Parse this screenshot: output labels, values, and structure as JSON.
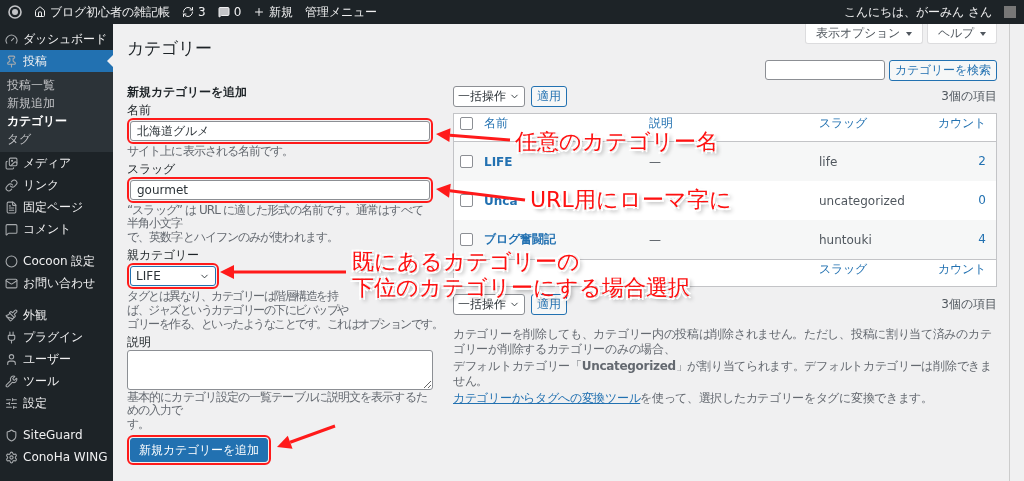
{
  "admin_bar": {
    "site_name": "ブログ初心者の雑記帳",
    "updates": "3",
    "comments": "0",
    "new_label": "新規",
    "menu_label": "管理メニュー",
    "greeting": "こんにちは、がーみん さん"
  },
  "sidebar": {
    "items": [
      {
        "label": "ダッシュボード",
        "selected": false
      },
      {
        "label": "投稿",
        "selected": true,
        "children": [
          {
            "label": "投稿一覧",
            "selected": false
          },
          {
            "label": "新規追加",
            "selected": false
          },
          {
            "label": "カテゴリー",
            "selected": true
          },
          {
            "label": "タグ",
            "selected": false
          }
        ]
      },
      {
        "label": "メディア",
        "selected": false
      },
      {
        "label": "リンク",
        "selected": false
      },
      {
        "label": "固定ページ",
        "selected": false
      },
      {
        "label": "コメント",
        "selected": false
      },
      {
        "label": "Cocoon 設定",
        "selected": false
      },
      {
        "label": "お問い合わせ",
        "selected": false
      },
      {
        "label": "外観",
        "selected": false
      },
      {
        "label": "プラグイン",
        "selected": false
      },
      {
        "label": "ユーザー",
        "selected": false
      },
      {
        "label": "ツール",
        "selected": false
      },
      {
        "label": "設定",
        "selected": false
      },
      {
        "label": "SiteGuard",
        "selected": false
      },
      {
        "label": "ConoHa WING",
        "selected": false
      }
    ]
  },
  "screen_tabs": [
    "表示オプション",
    "ヘルプ"
  ],
  "title": "カテゴリー",
  "search": {
    "button": "カテゴリーを検索"
  },
  "form": {
    "heading": "新規カテゴリーを追加",
    "fields": [
      {
        "kind": "text",
        "label": "名前",
        "value": "北海道グルメ",
        "highlighted": true,
        "help": [
          "サイト上に表示される名前です。"
        ]
      },
      {
        "kind": "text",
        "label": "スラッグ",
        "value": "gourmet",
        "highlighted": true,
        "help": [
          "“スラッグ” は URL に適した形式の名前です。通常はすべて半角小文字",
          "で、英数字とハイフンのみが使われます。"
        ]
      },
      {
        "kind": "select",
        "label": "親カテゴリー",
        "value": "LIFE",
        "highlighted": true,
        "help": [
          "タグとは異なり、カテゴリーは階層構造を持",
          "ば、ジャズというカテゴリーの下にビバップや",
          "ゴリーを作る、といったようなことです。これはオプションです。"
        ]
      },
      {
        "kind": "textarea",
        "label": "説明",
        "help": [
          "基本的にカテゴリ設定の一覧テーブルに説明文を表示するための入力で",
          "す。"
        ]
      }
    ],
    "submit": "新規カテゴリーを追加",
    "submit_highlighted": true
  },
  "table": {
    "top_nav": {
      "bulk_action": "一括操作",
      "apply": "適用",
      "item_count": "3個の項目"
    },
    "select_all_checked": false,
    "columns": [
      "名前",
      "説明",
      "スラッグ",
      "カウント"
    ],
    "rows": [
      {
        "name": "LIFE",
        "description": "—",
        "slug": "life",
        "count": "2",
        "checked": false
      },
      {
        "name": "Unca",
        "description": "",
        "slug": "uncategorized",
        "count": "0",
        "checked": false
      },
      {
        "name": "ブログ奮闘記",
        "description": "—",
        "slug": "huntouki",
        "count": "4",
        "checked": false
      }
    ],
    "footer_columns": [
      "スラッグ",
      "カウント"
    ],
    "bottom_nav": {
      "bulk_action": "一括操作",
      "apply": "適用",
      "item_count": "3個の項目"
    }
  },
  "notes": {
    "paragraphs": [
      "カテゴリーを削除しても、カテゴリー内の投稿は削除されません。ただし、投稿に割り当て済みのカテゴリーが削除するカテゴリーのみの場合、",
      "デフォルトカテゴリー「**Uncategorized**」が割り当てられます。デフォルトカテゴリーは削除できません。"
    ],
    "link": "カテゴリーからタグへの変換ツール",
    "link_suffix": "を使って、選択したカテゴリーをタグに変換できます。"
  },
  "annotations": [
    "任意のカテゴリー名",
    "URL用にローマ字に",
    "既にあるカテゴリーの",
    "下位のカテゴリーにする場合選択"
  ]
}
